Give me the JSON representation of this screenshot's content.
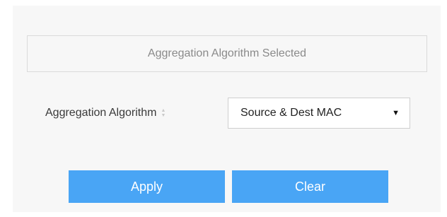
{
  "section": {
    "header": "Aggregation Algorithm Selected"
  },
  "form": {
    "label": "Aggregation Algorithm",
    "sort_icon": "sort-icon",
    "select": {
      "value": "Source & Dest MAC",
      "arrow_icon": "triangle-down-icon"
    }
  },
  "buttons": {
    "apply": "Apply",
    "clear": "Clear"
  },
  "colors": {
    "button_bg": "#49a5f5",
    "panel_bg": "#f7f7f7"
  }
}
